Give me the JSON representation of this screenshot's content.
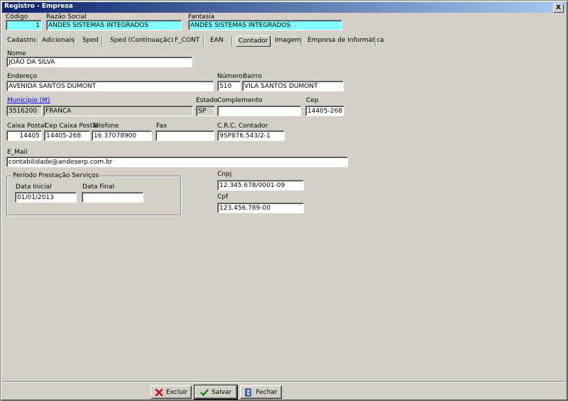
{
  "window": {
    "title": "Registro - Empresa",
    "close_label": "X"
  },
  "header": {
    "codigo_label": "Código",
    "codigo_value": "1",
    "razao_label": "Razão Social",
    "razao_value": "ANDES SISTEMAS INTEGRADOS",
    "fantasia_label": "Fantasia",
    "fantasia_value": "ANDES SISTEMAS INTEGRADOS"
  },
  "tabs": [
    "Cadastro",
    "Adicionais",
    "Sped",
    "Sped (Continuação)",
    "F_CONT",
    "EAN",
    "Contador",
    "Imagem",
    "Empresa de Informática"
  ],
  "active_tab": "Contador",
  "form": {
    "nome_label": "Nome",
    "nome_value": "JOÃO DA SILVA",
    "endereco_label": "Endereço",
    "endereco_value": "AVENIDA SANTOS DUMONT",
    "numero_label": "Número",
    "numero_value": "510",
    "bairro_label": "Bairro",
    "bairro_value": "VILA SANTOS DUMONT",
    "municipio_label": "Município (M)",
    "municipio_code": "3516200",
    "municipio_name": "FRANCA",
    "estado_label": "Estado",
    "estado_value": "SP",
    "complemento_label": "Complemento",
    "complemento_value": "",
    "cep_label": "Cep",
    "cep_value": "14405-268",
    "caixa_postal_label": "Caixa Postal",
    "caixa_postal_value": "14405",
    "cep_caixa_label": "Cep Caixa Postal",
    "cep_caixa_value": "14405-268",
    "telefone_label": "Telefone",
    "telefone_value": "16 37078900",
    "fax_label": "Fax",
    "fax_value": "",
    "crc_label": "C.R.C. Contador",
    "crc_value": "9SP876.543/2-1",
    "email_label": "E_Mail",
    "email_value": "contabilidade@andeserp.com.br",
    "periodo_title": "Período Prestação Serviços",
    "data_inicial_label": "Data Inicial",
    "data_inicial_value": "01/01/2013",
    "data_final_label": "Data Final",
    "data_final_value": "",
    "cnpj_label": "Cnpj",
    "cnpj_value": "12.345.678/0001-09",
    "cpf_label": "Cpf",
    "cpf_value": "123.456.789-00"
  },
  "buttons": {
    "excluir": "Excluir",
    "salvar": "Salvar",
    "fechar": "Fechar"
  },
  "colors": {
    "highlight_field": "#80ffff",
    "title_start": "#0a246a",
    "title_end": "#a6caf0",
    "link": "#0000ff"
  }
}
